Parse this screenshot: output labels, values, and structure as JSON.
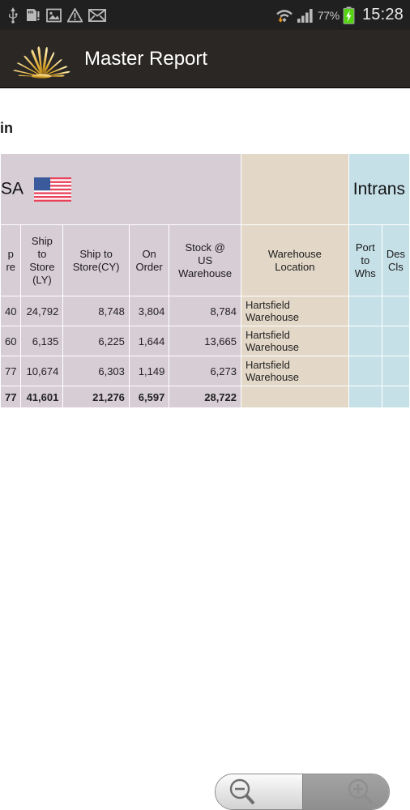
{
  "statusbar": {
    "icons_left": [
      "usb-icon",
      "sdcard-alert-icon",
      "image-icon",
      "warning-icon",
      "mail-icon"
    ],
    "wifi_icon": "wifi-download-icon",
    "signal_icon": "signal-bars-icon",
    "battery_percent": "77%",
    "battery_icon": "battery-charging-icon",
    "clock": "15:28"
  },
  "actionbar": {
    "logo_icon": "sunburst-logo-icon",
    "title": "Master Report"
  },
  "report": {
    "title_fragment": "in",
    "group_headers": [
      {
        "label": "SA",
        "flag_icon": "us-flag-icon",
        "color": "#d7cdd5",
        "clipped_left": true
      },
      {
        "label": "",
        "color": "#e3d8c8"
      },
      {
        "label": "Intrans",
        "color": "#c6e0e8",
        "clipped_right": true
      }
    ],
    "columns": [
      {
        "label_lines": [
          "p",
          "re"
        ],
        "align": "right",
        "group": 0,
        "clipped": true
      },
      {
        "label_lines": [
          "Ship",
          "to",
          "Store",
          "(LY)"
        ],
        "align": "right",
        "group": 0
      },
      {
        "label_lines": [
          "Ship to",
          "Store(CY)"
        ],
        "align": "right",
        "group": 0
      },
      {
        "label_lines": [
          "On",
          "Order"
        ],
        "align": "right",
        "group": 0
      },
      {
        "label_lines": [
          "Stock @",
          "US",
          "Warehouse"
        ],
        "align": "right",
        "group": 0
      },
      {
        "label_lines": [
          "Warehouse",
          "Location"
        ],
        "align": "left",
        "group": 1
      },
      {
        "label_lines": [
          "Port",
          "to",
          "Whs"
        ],
        "align": "right",
        "group": 2
      },
      {
        "label_lines": [
          "Des",
          "Cls"
        ],
        "align": "right",
        "group": 2,
        "clipped": true
      }
    ],
    "rows": [
      {
        "cells": [
          "40",
          "24,792",
          "8,748",
          "3,804",
          "8,784",
          "Hartsfield Warehouse",
          "",
          ""
        ]
      },
      {
        "cells": [
          "60",
          "6,135",
          "6,225",
          "1,644",
          "13,665",
          "Hartsfield Warehouse",
          "",
          ""
        ]
      },
      {
        "cells": [
          "77",
          "10,674",
          "6,303",
          "1,149",
          "6,273",
          "Hartsfield Warehouse",
          "",
          ""
        ]
      }
    ],
    "total_row": {
      "cells": [
        "77",
        "41,601",
        "21,276",
        "6,597",
        "28,722",
        "",
        "",
        ""
      ]
    }
  },
  "zoom_control": {
    "zoom_out_label": "zoom-out",
    "zoom_out_icon": "magnifier-minus-icon",
    "zoom_in_label": "zoom-in",
    "zoom_in_icon": "magnifier-plus-icon"
  }
}
